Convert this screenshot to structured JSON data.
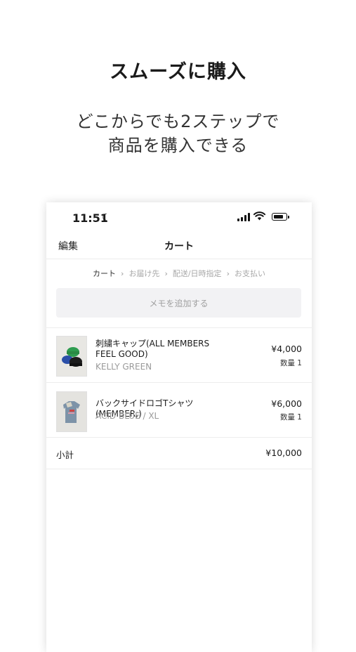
{
  "promo": {
    "headline": "スムーズに購入",
    "sub_line1": "どこからでも2ステップで",
    "sub_line2": "商品を購入できる"
  },
  "status_bar": {
    "time": "11:51",
    "moon": "☾"
  },
  "navbar": {
    "edit_label": "編集",
    "title": "カート"
  },
  "steps": {
    "cart": "カート",
    "address": "お届け先",
    "delivery": "配送/日時指定",
    "payment": "お支払い",
    "separator": "›"
  },
  "memo": {
    "label": "メモを追加する"
  },
  "cart_items": [
    {
      "name": "刺繍キャップ(ALL MEMBERS FEEL GOOD)",
      "variant": "KELLY GREEN",
      "price": "¥4,000",
      "quantity": "数量 1"
    },
    {
      "name": "バックサイドロゴTシャツ (MEMBER;)",
      "variant": "ACID BLUE / XL",
      "price": "¥6,000",
      "quantity": "数量 1"
    }
  ],
  "subtotal": {
    "label": "小計",
    "value": "¥10,000"
  },
  "colors": {
    "memo_bg": "#f2f2f4",
    "muted_text": "#9a9a9a"
  }
}
